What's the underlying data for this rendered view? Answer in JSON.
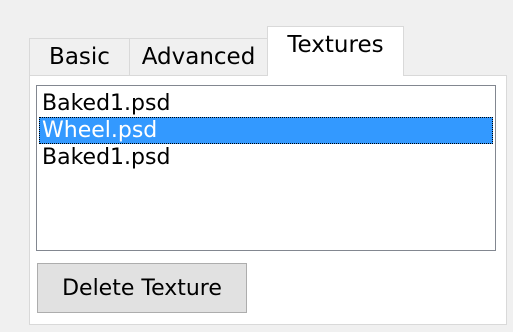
{
  "tabs": [
    {
      "label": "Basic",
      "active": false
    },
    {
      "label": "Advanced",
      "active": false
    },
    {
      "label": "Textures",
      "active": true
    }
  ],
  "textures": {
    "items": [
      {
        "label": "Baked1.psd",
        "selected": false
      },
      {
        "label": "Wheel.psd",
        "selected": true
      },
      {
        "label": "Baked1.psd",
        "selected": false
      }
    ],
    "delete_label": "Delete Texture"
  },
  "colors": {
    "selection": "#3399ff",
    "background": "#f0f0f0",
    "button": "#e1e1e1"
  }
}
